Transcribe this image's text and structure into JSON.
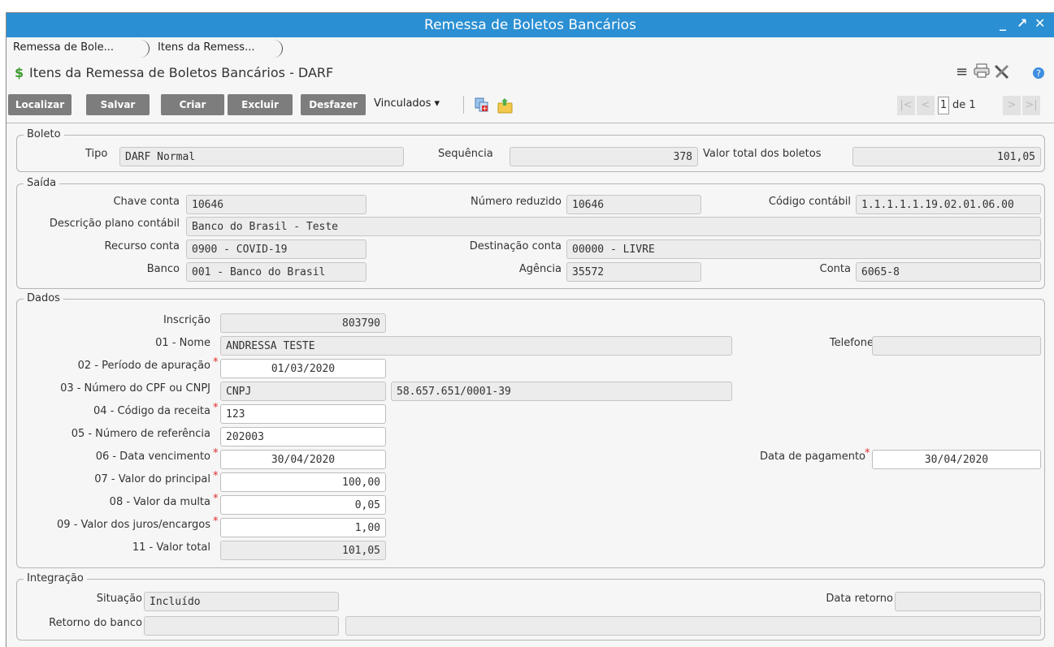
{
  "window": {
    "title": "Remessa de Boletos Bancários",
    "controls": {
      "minimize": "_",
      "maximize": "↗",
      "close": "✕"
    }
  },
  "tabs": [
    {
      "label": "Remessa de Bole..."
    },
    {
      "label": "Itens da Remess..."
    }
  ],
  "subheader": {
    "title": "Itens da Remessa de Boletos Bancários - DARF",
    "icons": [
      "menu-icon",
      "print-icon",
      "tools-icon",
      "help-icon"
    ]
  },
  "toolbar": {
    "buttons": [
      "Localizar",
      "Salvar",
      "Criar",
      "Excluir",
      "Desfazer"
    ],
    "vinculados_label": "Vinculados",
    "pager": {
      "current": "1",
      "of_label": "de 1"
    }
  },
  "boleto": {
    "legend": "Boleto",
    "tipo_label": "Tipo",
    "tipo_value": "DARF Normal",
    "sequencia_label": "Sequência",
    "sequencia_value": "378",
    "valor_total_label": "Valor total dos boletos",
    "valor_total_value": "101,05"
  },
  "saida": {
    "legend": "Saída",
    "chave_conta_label": "Chave conta",
    "chave_conta_value": "10646",
    "numero_reduzido_label": "Número reduzido",
    "numero_reduzido_value": "10646",
    "codigo_contabil_label": "Código contábil",
    "codigo_contabil_value": "1.1.1.1.1.19.02.01.06.00",
    "descricao_label": "Descrição plano contábil",
    "descricao_value": "Banco do Brasil - Teste",
    "recurso_label": "Recurso conta",
    "recurso_value": "0900 - COVID-19",
    "destinacao_label": "Destinação conta",
    "destinacao_value": "00000 - LIVRE",
    "banco_label": "Banco",
    "banco_value": "001 - Banco do Brasil",
    "agencia_label": "Agência",
    "agencia_value": "35572",
    "conta_label": "Conta",
    "conta_value": "6065-8"
  },
  "dados": {
    "legend": "Dados",
    "inscricao_label": "Inscrição",
    "inscricao_value": "803790",
    "nome_label": "01 - Nome",
    "nome_value": "ANDRESSA TESTE",
    "telefone_label": "Telefone",
    "telefone_value": "",
    "periodo_label": "02 - Período de apuração",
    "periodo_value": "01/03/2020",
    "cpf_cnpj_label": "03 - Número do CPF ou CNPJ",
    "cpf_cnpj_type": "CNPJ",
    "cpf_cnpj_value": "58.657.651/0001-39",
    "codigo_receita_label": "04 - Código da receita",
    "codigo_receita_value": "123",
    "referencia_label": "05 - Número de referência",
    "referencia_value": "202003",
    "vencimento_label": "06 - Data vencimento",
    "vencimento_value": "30/04/2020",
    "pagamento_label": "Data de pagamento",
    "pagamento_value": "30/04/2020",
    "principal_label": "07 - Valor do principal",
    "principal_value": "100,00",
    "multa_label": "08 - Valor da multa",
    "multa_value": "0,05",
    "juros_label": "09 - Valor dos juros/encargos",
    "juros_value": "1,00",
    "total_label": "11 - Valor total",
    "total_value": "101,05",
    "required_mark": "*"
  },
  "integracao": {
    "legend": "Integração",
    "situacao_label": "Situação",
    "situacao_value": "Incluído",
    "data_retorno_label": "Data retorno",
    "data_retorno_value": "",
    "retorno_banco_label": "Retorno do banco",
    "retorno_banco_value": "",
    "retorno_banco_detail": ""
  },
  "colors": {
    "titlebar": "#2b8fd3",
    "button": "#7d7d7d",
    "required": "#e02b2b"
  }
}
